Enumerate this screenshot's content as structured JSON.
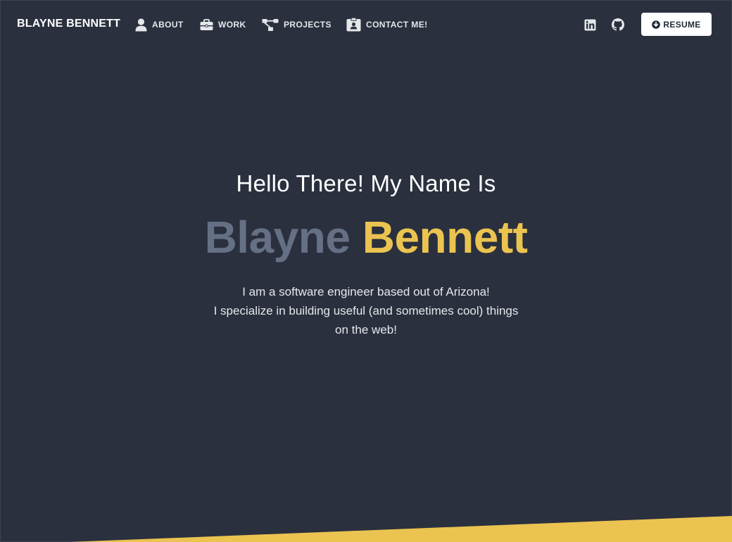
{
  "brand": {
    "name": "BLAYNE BENNETT"
  },
  "nav": {
    "items": [
      {
        "label": "ABOUT",
        "icon": "user-icon"
      },
      {
        "label": "WORK",
        "icon": "briefcase-icon"
      },
      {
        "label": "PROJECTS",
        "icon": "project-diagram-icon"
      },
      {
        "label": "CONTACT ME!",
        "icon": "id-badge-icon"
      }
    ],
    "social": [
      {
        "icon": "linkedin-icon"
      },
      {
        "icon": "github-icon"
      }
    ],
    "resume_label": "RESUME",
    "resume_icon": "arrow-circle-down-icon"
  },
  "hero": {
    "greeting": "Hello There! My Name Is",
    "first_name": "Blayne",
    "last_name": "Bennett",
    "bio_lines": [
      "I am a software engineer based out of Arizona!",
      "I specialize in building useful (and sometimes cool) things",
      "on the web!"
    ]
  },
  "colors": {
    "background": "#2a303e",
    "first_name": "#667085",
    "accent": "#ebc350",
    "text": "#ffffff",
    "muted_text": "#e5e7eb"
  }
}
